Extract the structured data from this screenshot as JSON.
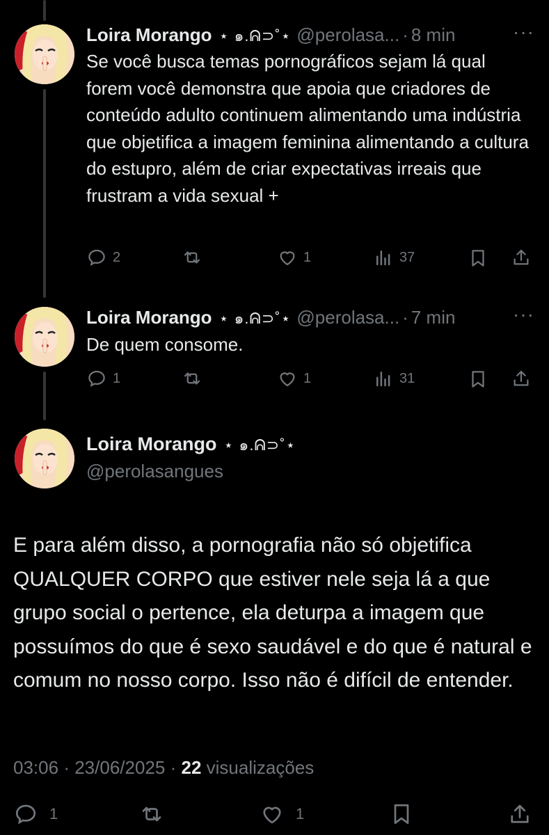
{
  "tweets": [
    {
      "name": "Loira Morango",
      "deco": "⋆ ๑.ᕱ⊃˚⋆",
      "handle": "@perolasa...",
      "separator": "·",
      "time": "8 min",
      "more": "···",
      "text": "Se você busca temas pornográficos sejam lá qual forem você demonstra que apoia que criadores de conteúdo adulto continuem alimentando uma indústria que objetifica a imagem feminina alimentando a cultura do estupro, além de criar expectativas irreais que frustram a vida sexual +",
      "replies": "2",
      "likes": "1",
      "views": "37"
    },
    {
      "name": "Loira Morango",
      "deco": "⋆ ๑.ᕱ⊃˚⋆",
      "handle": "@perolasa...",
      "separator": "·",
      "time": "7 min",
      "more": "···",
      "text": "De quem consome.",
      "replies": "1",
      "likes": "1",
      "views": "31"
    }
  ],
  "main_tweet": {
    "name": "Loira Morango",
    "deco": "⋆ ๑.ᕱ⊃˚⋆",
    "handle": "@perolasangues",
    "text": "E para além disso, a pornografia não só objetifica QUALQUER CORPO que estiver nele seja lá a que grupo social o pertence, ela deturpa a imagem que possuímos do que é sexo saudável e do que é natural e comum no nosso corpo. Isso não é difícil de entender.",
    "time": "03:06",
    "sep1": "·",
    "date": "23/06/2025",
    "sep2": "·",
    "views_count": "22",
    "views_label": "visualizações",
    "replies": "1",
    "likes": "1"
  },
  "icons": [
    "reply-icon",
    "retweet-icon",
    "like-icon",
    "views-icon",
    "bookmark-icon",
    "share-icon"
  ],
  "colors": {
    "background": "#000000",
    "text": "#e7e9ea",
    "secondary": "#71767b"
  }
}
